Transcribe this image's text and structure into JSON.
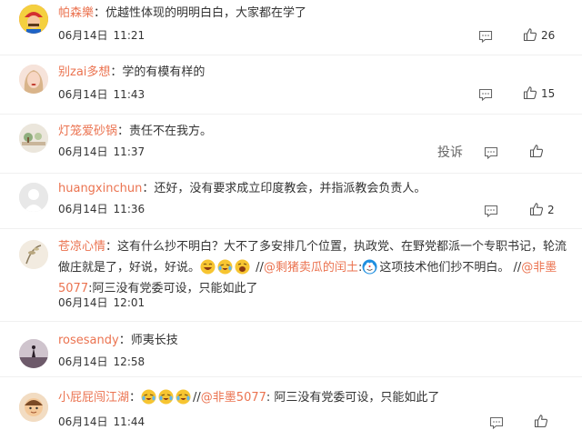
{
  "comments": [
    {
      "user": "帕森樂",
      "segments": [
        {
          "t": "：优越性体现的明明白白，大家都在学了"
        }
      ],
      "date": "06月14日",
      "time": "11:21",
      "likes": "26"
    },
    {
      "user": "别zai多想",
      "segments": [
        {
          "t": "：学的有模有样的"
        }
      ],
      "date": "06月14日",
      "time": "11:43",
      "likes": "15"
    },
    {
      "user": "灯笼爱砂锅",
      "segments": [
        {
          "t": "：责任不在我方。"
        }
      ],
      "date": "06月14日",
      "time": "11:37",
      "likes": "",
      "report": "投诉"
    },
    {
      "user": "huangxinchun",
      "segments": [
        {
          "t": "：还好，没有要求成立印度教会，并指派教会负责人。"
        }
      ],
      "date": "06月14日",
      "time": "11:36",
      "likes": "2"
    },
    {
      "user": "苍凉心情",
      "segments": [
        {
          "t": "：这有什么抄不明白？大不了多安排几个位置，执政党、在野党都派一个专职书记，轮流做庄就是了，好说，好说。"
        },
        {
          "emoji": "laugh"
        },
        {
          "emoji": "cry-laugh"
        },
        {
          "emoji": "laugh-big"
        },
        {
          "t": " //"
        },
        {
          "at": "@剩猪卖瓜的闰土"
        },
        {
          "t": ":"
        },
        {
          "emoji": "doraemon"
        },
        {
          "t": "这项技术他们抄不明白。 //"
        },
        {
          "at": "@非墨5077"
        },
        {
          "t": ":阿三没有党委可设，只能如此了"
        }
      ],
      "date": "06月14日",
      "time": "12:01",
      "likes": ""
    },
    {
      "user": "rosesandy",
      "segments": [
        {
          "t": "：师夷长技"
        }
      ],
      "date": "06月14日",
      "time": "12:58",
      "likes": ""
    },
    {
      "user": "小屁屁闯江湖",
      "segments": [
        {
          "t": "："
        },
        {
          "emoji": "cry-laugh"
        },
        {
          "emoji": "cry-laugh"
        },
        {
          "emoji": "cry-laugh"
        },
        {
          "t": "//"
        },
        {
          "at": "@非墨5077"
        },
        {
          "t": ": 阿三没有党委可设，只能如此了"
        }
      ],
      "date": "06月14日",
      "time": "11:44",
      "likes": ""
    }
  ],
  "colors": {
    "username": "#eb7350",
    "text": "#333333",
    "divider": "#f0f0f0"
  },
  "icons": {
    "reply": "comment-icon",
    "like": "thumbs-up-icon"
  }
}
